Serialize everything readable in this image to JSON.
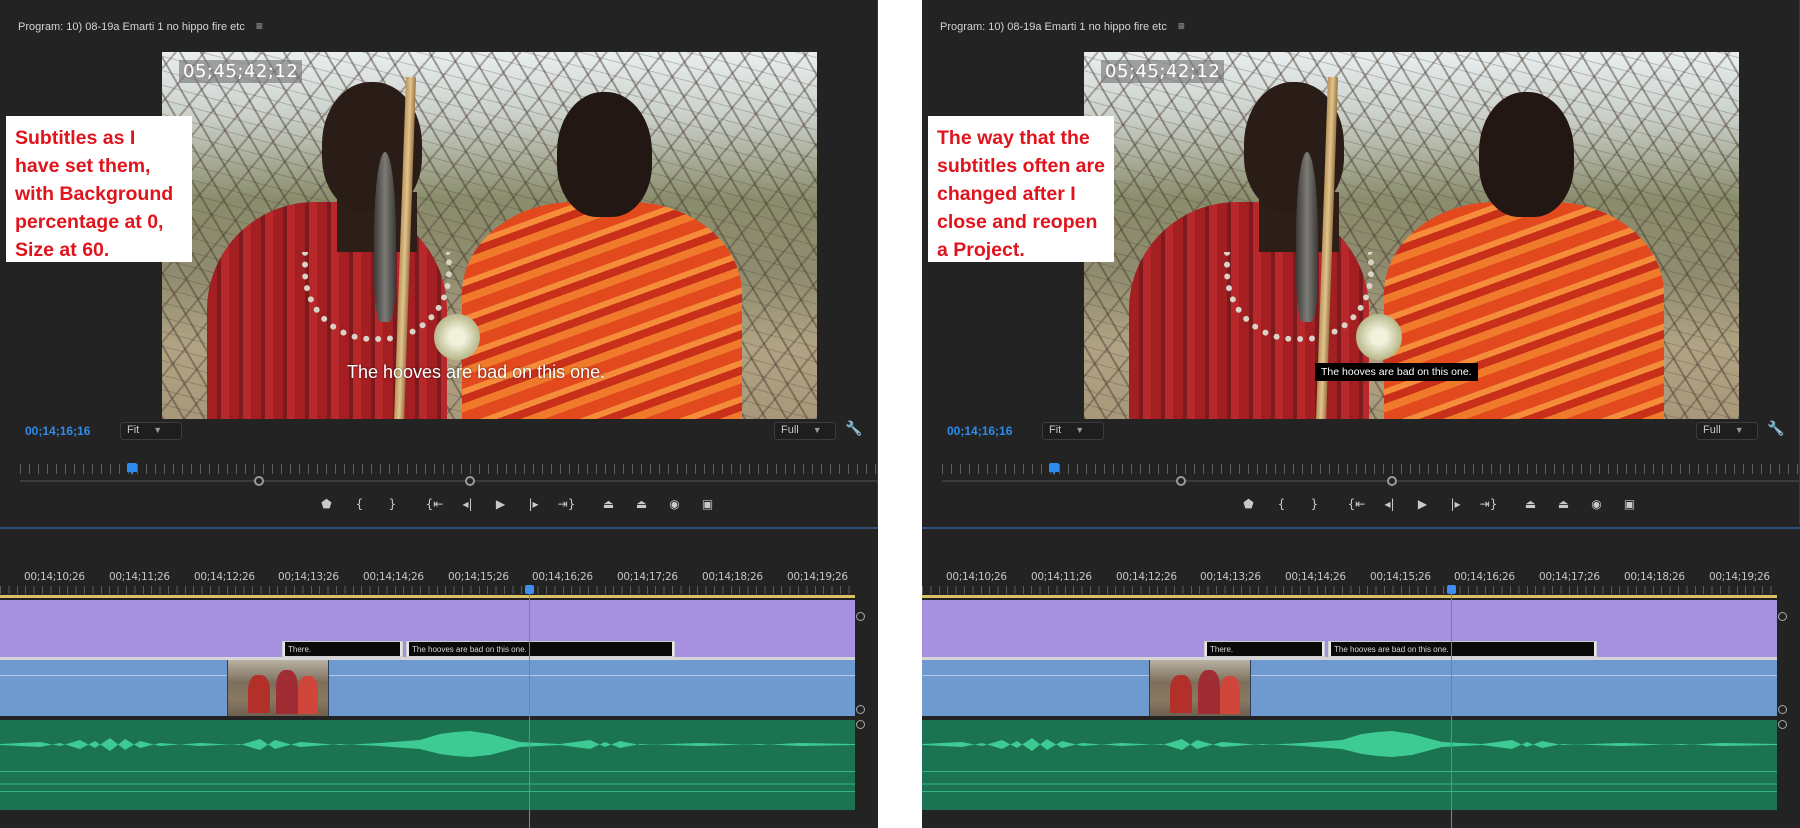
{
  "panels": [
    {
      "id": "left",
      "monitor_title": "Program: 10)  08-19a Emarti 1 no hippo fire etc",
      "menu_glyph": "≡",
      "overlay_timecode": "05;45;42;12",
      "subtitle_text": "The hooves are bad on this one.",
      "note_text": "Subtitles as I have set them, with Background percentage at 0, Size at 60.",
      "playhead_timecode": "00;14;16;16",
      "fit_label": "Fit",
      "full_label": "Full",
      "caption_clips": [
        "There.",
        "The hooves are bad on this one."
      ]
    },
    {
      "id": "right",
      "monitor_title": "Program: 10)  08-19a Emarti 1 no hippo fire etc",
      "menu_glyph": "≡",
      "overlay_timecode": "05;45;42;12",
      "subtitle_text": "The hooves are bad on this one.",
      "note_text": "The way that the subtitles often are changed after I close and reopen a Project.",
      "playhead_timecode": "00;14;16;16",
      "fit_label": "Fit",
      "full_label": "Full",
      "caption_clips": [
        "There.",
        "The hooves are bad on this one."
      ]
    }
  ],
  "timeline": {
    "ticks": [
      "00;14;10;26",
      "00;14;11;26",
      "00;14;12;26",
      "00;14;13;26",
      "00;14;14;26",
      "00;14;15;26",
      "00;14;16;26",
      "00;14;17;26",
      "00;14;18;26",
      "00;14;19;26"
    ]
  },
  "transport_icons": [
    "marker-icon",
    "mark-in-icon",
    "mark-out-icon",
    "go-to-in-icon",
    "step-back-icon",
    "play-icon",
    "step-forward-icon",
    "go-to-out-icon",
    "lift-icon",
    "extract-icon",
    "export-frame-icon",
    "comparison-view-icon"
  ],
  "colors": {
    "panel_bg": "#232323",
    "timecode_blue": "#2d8ceb",
    "caption_track": "#a591df",
    "video_track": "#6f9ad0",
    "audio_track": "#1c7351",
    "note_red": "#e0141d"
  }
}
